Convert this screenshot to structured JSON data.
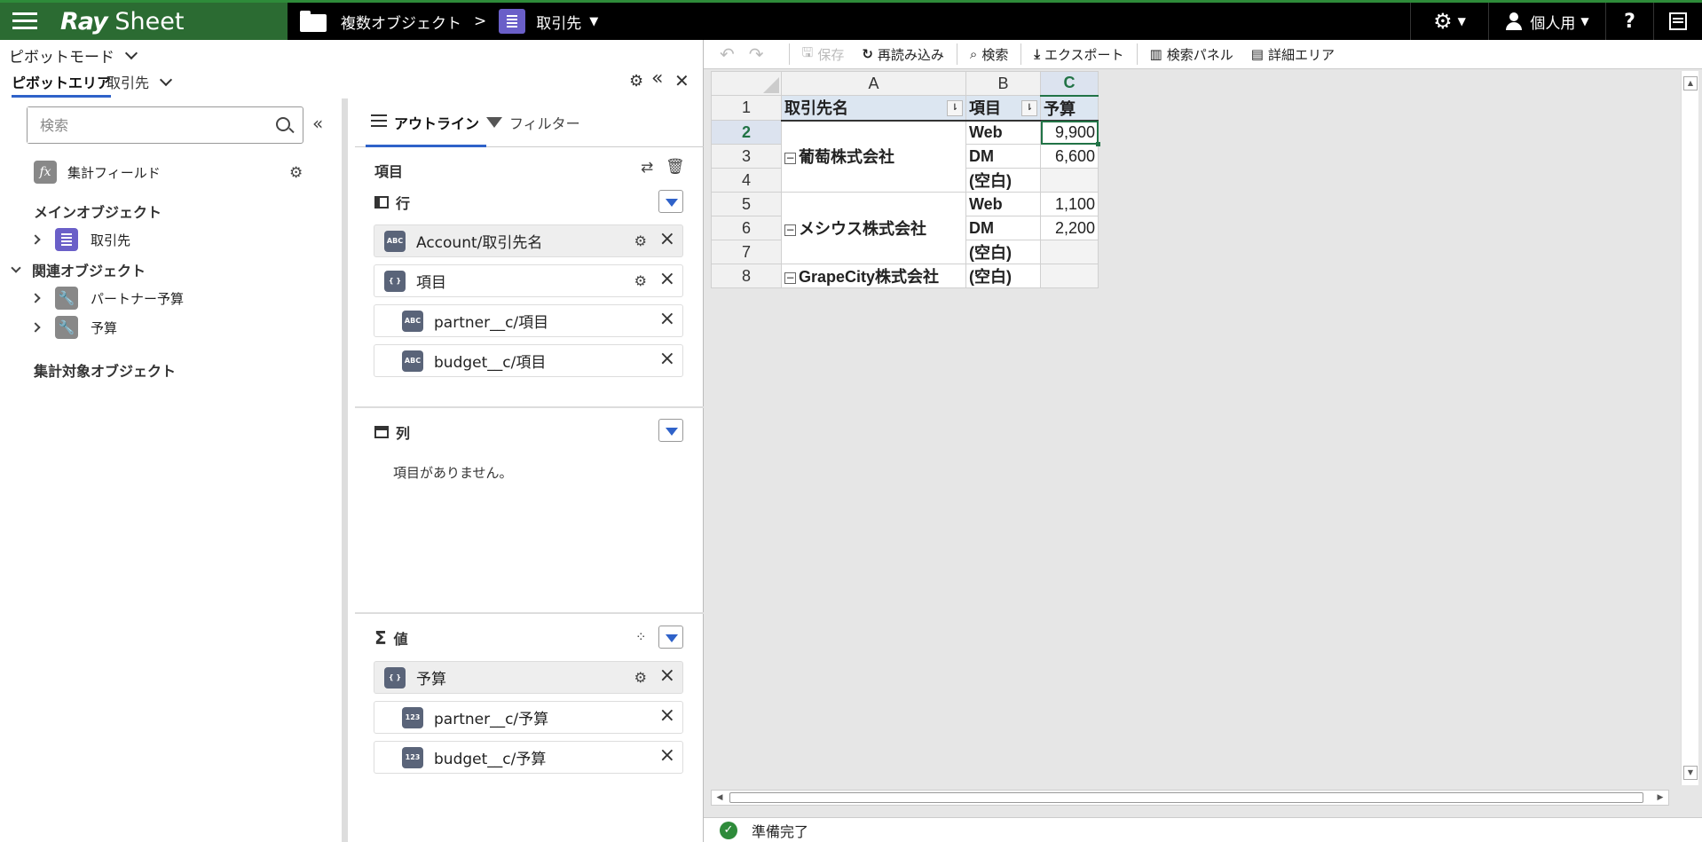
{
  "app": {
    "logo_ray": "Ray",
    "logo_sheet": "Sheet"
  },
  "breadcrumb": {
    "root": "複数オブジェクト",
    "separator": ">",
    "current": "取引先"
  },
  "topbar": {
    "user_label": "個人用",
    "help_label": "?"
  },
  "left": {
    "mode_label": "ピボットモード",
    "tab_pivot_area": "ピボットエリア",
    "tab_object": "取引先",
    "search_placeholder": "検索",
    "calc_field_label": "集計フィールド",
    "main_object_heading": "メインオブジェクト",
    "main_object_item": "取引先",
    "related_heading": "関連オブジェクト",
    "related_items": [
      "パートナー予算",
      "予算"
    ],
    "aggregate_heading": "集計対象オブジェクト"
  },
  "outline": {
    "tab_outline": "アウトライン",
    "tab_filter": "フィルター",
    "fields_heading": "項目",
    "rows_heading": "行",
    "rows": [
      {
        "type_icon": "ABC",
        "label": "Account/取引先名"
      },
      {
        "type_icon": "{ }",
        "label": "項目"
      },
      {
        "type_icon": "ABC",
        "label": "partner__c/項目"
      },
      {
        "type_icon": "ABC",
        "label": "budget__c/項目"
      }
    ],
    "columns_heading": "列",
    "columns_empty": "項目がありません。",
    "values_heading": "値",
    "values_symbol": "Σ",
    "values": [
      {
        "type_icon": "{ }",
        "label": "予算"
      },
      {
        "type_icon": "123",
        "label": "partner__c/予算"
      },
      {
        "type_icon": "123",
        "label": "budget__c/予算"
      }
    ]
  },
  "sheet_toolbar": {
    "undo": "↶",
    "redo": "↷",
    "save": "保存",
    "reload": "再読み込み",
    "search": "検索",
    "export": "エクスポート",
    "search_panel": "検索パネル",
    "detail_area": "詳細エリア"
  },
  "grid": {
    "col_headers": [
      "A",
      "B",
      "C"
    ],
    "row_headers": [
      "1",
      "2",
      "3",
      "4",
      "5",
      "6",
      "7",
      "8"
    ],
    "header_row": [
      "取引先名",
      "項目",
      "予算"
    ],
    "groups": [
      {
        "name": "葡萄株式会社",
        "items": [
          [
            "Web",
            "9,900"
          ],
          [
            "DM",
            "6,600"
          ],
          [
            "(空白)",
            ""
          ]
        ]
      },
      {
        "name": "メシウス株式会社",
        "items": [
          [
            "Web",
            "1,100"
          ],
          [
            "DM",
            "2,200"
          ],
          [
            "(空白)",
            ""
          ]
        ]
      },
      {
        "name": "GrapeCity株式会社",
        "items": [
          [
            "(空白)",
            ""
          ]
        ]
      }
    ]
  },
  "status": {
    "text": "準備完了"
  }
}
